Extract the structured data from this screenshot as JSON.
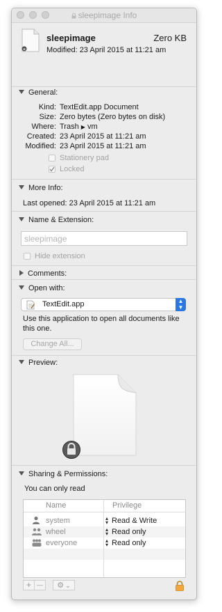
{
  "window": {
    "title": "sleepimage Info"
  },
  "header": {
    "file_name": "sleepimage",
    "file_size": "Zero KB",
    "modified": "Modified: 23 April 2015 at 11:21 am"
  },
  "general": {
    "title": "General:",
    "rows": [
      {
        "label": "Kind:",
        "value": "TextEdit.app Document"
      },
      {
        "label": "Size:",
        "value": "Zero bytes (Zero bytes on disk)"
      },
      {
        "label": "Where:",
        "value_pre": "Trash",
        "value_post": "vm"
      },
      {
        "label": "Created:",
        "value": "23 April 2015 at 11:21 am"
      },
      {
        "label": "Modified:",
        "value": "23 April 2015 at 11:21 am"
      }
    ],
    "stationery_label": "Stationery pad",
    "stationery_checked": false,
    "locked_label": "Locked",
    "locked_checked": true
  },
  "more_info": {
    "title": "More Info:",
    "last_opened": "Last opened: 23 April 2015 at 11:21 am"
  },
  "name_extension": {
    "title": "Name & Extension:",
    "field_value": "sleepimage",
    "hide_extension_label": "Hide extension"
  },
  "comments": {
    "title": "Comments:"
  },
  "open_with": {
    "title": "Open with:",
    "app": "TextEdit.app",
    "description": "Use this application to open all documents like this one.",
    "change_all_label": "Change All..."
  },
  "preview": {
    "title": "Preview:"
  },
  "sharing": {
    "title": "Sharing & Permissions:",
    "note": "You can only read",
    "columns": [
      "Name",
      "Privilege"
    ],
    "rows": [
      {
        "name": "system",
        "privilege": "Read & Write",
        "icon": "user-icon"
      },
      {
        "name": "wheel",
        "privilege": "Read only",
        "icon": "group-icon"
      },
      {
        "name": "everyone",
        "privilege": "Read only",
        "icon": "everyone-icon"
      }
    ],
    "add_label": "+",
    "remove_label": "—",
    "action_label": "⚙",
    "action_chevron": "⌄"
  },
  "colors": {
    "accent": "#2b78e4",
    "lock": "#f0a63a"
  }
}
